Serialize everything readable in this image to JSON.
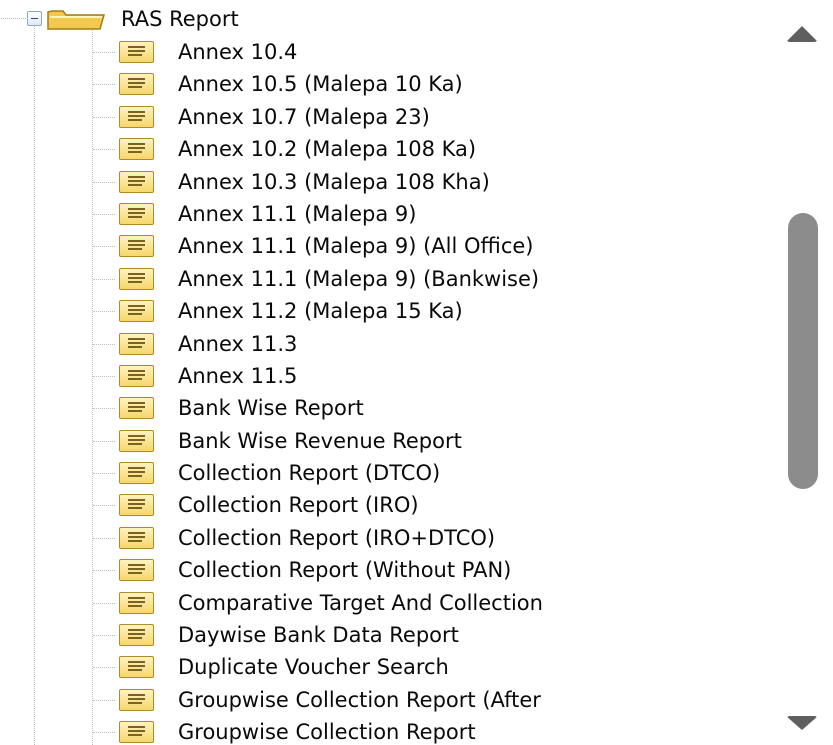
{
  "tree": {
    "root": {
      "label": "RAS Report",
      "expanded": true,
      "icon": "open-folder-icon"
    },
    "items": [
      {
        "label": "Annex 10.4",
        "icon": "report-document-icon"
      },
      {
        "label": "Annex 10.5 (Malepa 10 Ka)",
        "icon": "report-document-icon"
      },
      {
        "label": "Annex 10.7 (Malepa 23)",
        "icon": "report-document-icon"
      },
      {
        "label": "Annex 10.2 (Malepa 108 Ka)",
        "icon": "report-document-icon"
      },
      {
        "label": "Annex 10.3 (Malepa 108 Kha)",
        "icon": "report-document-icon"
      },
      {
        "label": "Annex 11.1 (Malepa 9)",
        "icon": "report-document-icon"
      },
      {
        "label": "Annex 11.1 (Malepa 9) (All Office)",
        "icon": "report-document-icon"
      },
      {
        "label": "Annex 11.1 (Malepa 9) (Bankwise)",
        "icon": "report-document-icon"
      },
      {
        "label": "Annex 11.2 (Malepa 15 Ka)",
        "icon": "report-document-icon"
      },
      {
        "label": "Annex 11.3",
        "icon": "report-document-icon"
      },
      {
        "label": "Annex 11.5",
        "icon": "report-document-icon"
      },
      {
        "label": "Bank Wise Report",
        "icon": "report-document-icon"
      },
      {
        "label": "Bank Wise Revenue Report",
        "icon": "report-document-icon"
      },
      {
        "label": "Collection Report (DTCO)",
        "icon": "report-document-icon"
      },
      {
        "label": "Collection Report (IRO)",
        "icon": "report-document-icon"
      },
      {
        "label": "Collection Report (IRO+DTCO)",
        "icon": "report-document-icon"
      },
      {
        "label": "Collection Report (Without PAN)",
        "icon": "report-document-icon"
      },
      {
        "label": "Comparative Target And Collection",
        "icon": "report-document-icon"
      },
      {
        "label": "Daywise Bank Data Report",
        "icon": "report-document-icon"
      },
      {
        "label": "Duplicate Voucher Search",
        "icon": "report-document-icon"
      },
      {
        "label": "Groupwise Collection Report (After",
        "icon": "report-document-icon"
      },
      {
        "label": "Groupwise Collection Report",
        "icon": "report-document-icon"
      }
    ]
  },
  "scrollbar": {
    "position_fraction": 0.27,
    "up_icon": "scroll-up-arrow-icon",
    "down_icon": "scroll-down-arrow-icon"
  },
  "colors": {
    "folder": "#f2c94c",
    "document": "#f6d76b",
    "scroll_thumb": "#8c8c8c",
    "text": "#0a0a0a"
  }
}
